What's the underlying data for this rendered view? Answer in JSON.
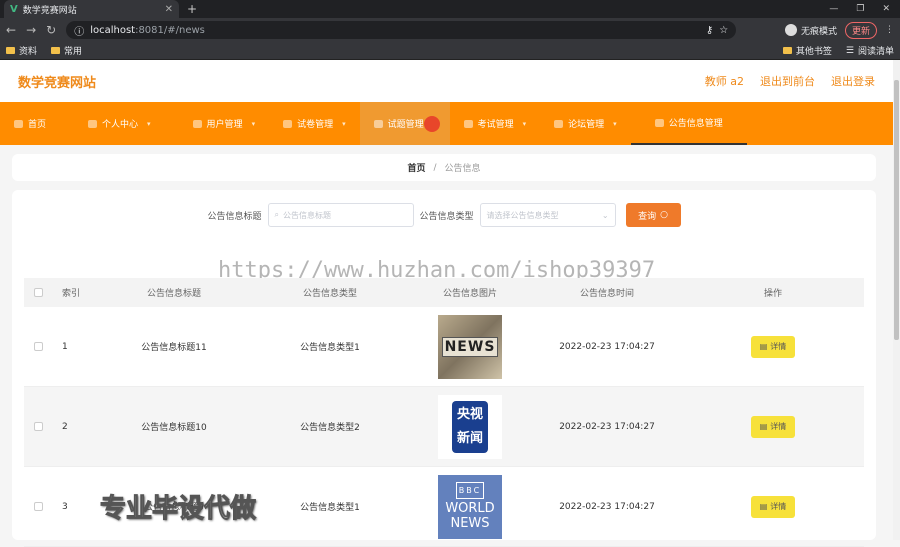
{
  "browser": {
    "tab_title": "数学竞赛网站",
    "url_host": "localhost",
    "url_path": ":8081/#/news",
    "incognito_label": "无痕模式",
    "update_label": "更新",
    "bookmarks": [
      "资料",
      "常用"
    ],
    "bookmarks_right": [
      "其他书签",
      "阅读清单"
    ]
  },
  "header": {
    "site_title": "数学竞赛网站",
    "user": "教师 a2",
    "back_to_admin": "退出到前台",
    "logout": "退出登录"
  },
  "nav": {
    "items": [
      {
        "label": "首页"
      },
      {
        "label": "个人中心"
      },
      {
        "label": "用户管理"
      },
      {
        "label": "试卷管理"
      },
      {
        "label": "试题管理"
      },
      {
        "label": "考试管理"
      },
      {
        "label": "论坛管理"
      },
      {
        "label": "公告信息管理"
      }
    ]
  },
  "breadcrumb": {
    "home": "首页",
    "separator": "/",
    "current": "公告信息"
  },
  "search": {
    "title_label": "公告信息标题",
    "title_placeholder": "公告信息标题",
    "type_label": "公告信息类型",
    "type_placeholder": "请选择公告信息类型",
    "query_button": "查询"
  },
  "watermark": "https://www.huzhan.com/ishop39397",
  "table": {
    "headers": [
      "索引",
      "公告信息标题",
      "公告信息类型",
      "公告信息图片",
      "公告信息时间",
      "操作"
    ],
    "rows": [
      {
        "index": "1",
        "title": "公告信息标题11",
        "type": "公告信息类型1",
        "image_text": "NEWS",
        "time": "2022-02-23 17:04:27",
        "action": "详情"
      },
      {
        "index": "2",
        "title": "公告信息标题10",
        "type": "公告信息类型2",
        "image_text_1": "央视",
        "image_text_2": "新闻",
        "time": "2022-02-23 17:04:27",
        "action": "详情"
      },
      {
        "index": "3",
        "title": "公告信息标题9",
        "type": "公告信息类型1",
        "image_badge": "BBC",
        "image_text_1": "WORLD",
        "image_text_2": "NEWS",
        "time": "2022-02-23 17:04:27",
        "action": "详情"
      }
    ]
  },
  "overlay_caption": "专业毕设代做",
  "colors": {
    "accent": "#ff8c00",
    "title": "#ef8a1b",
    "query_button": "#ef7a2a",
    "detail_button": "#f7e13a"
  }
}
